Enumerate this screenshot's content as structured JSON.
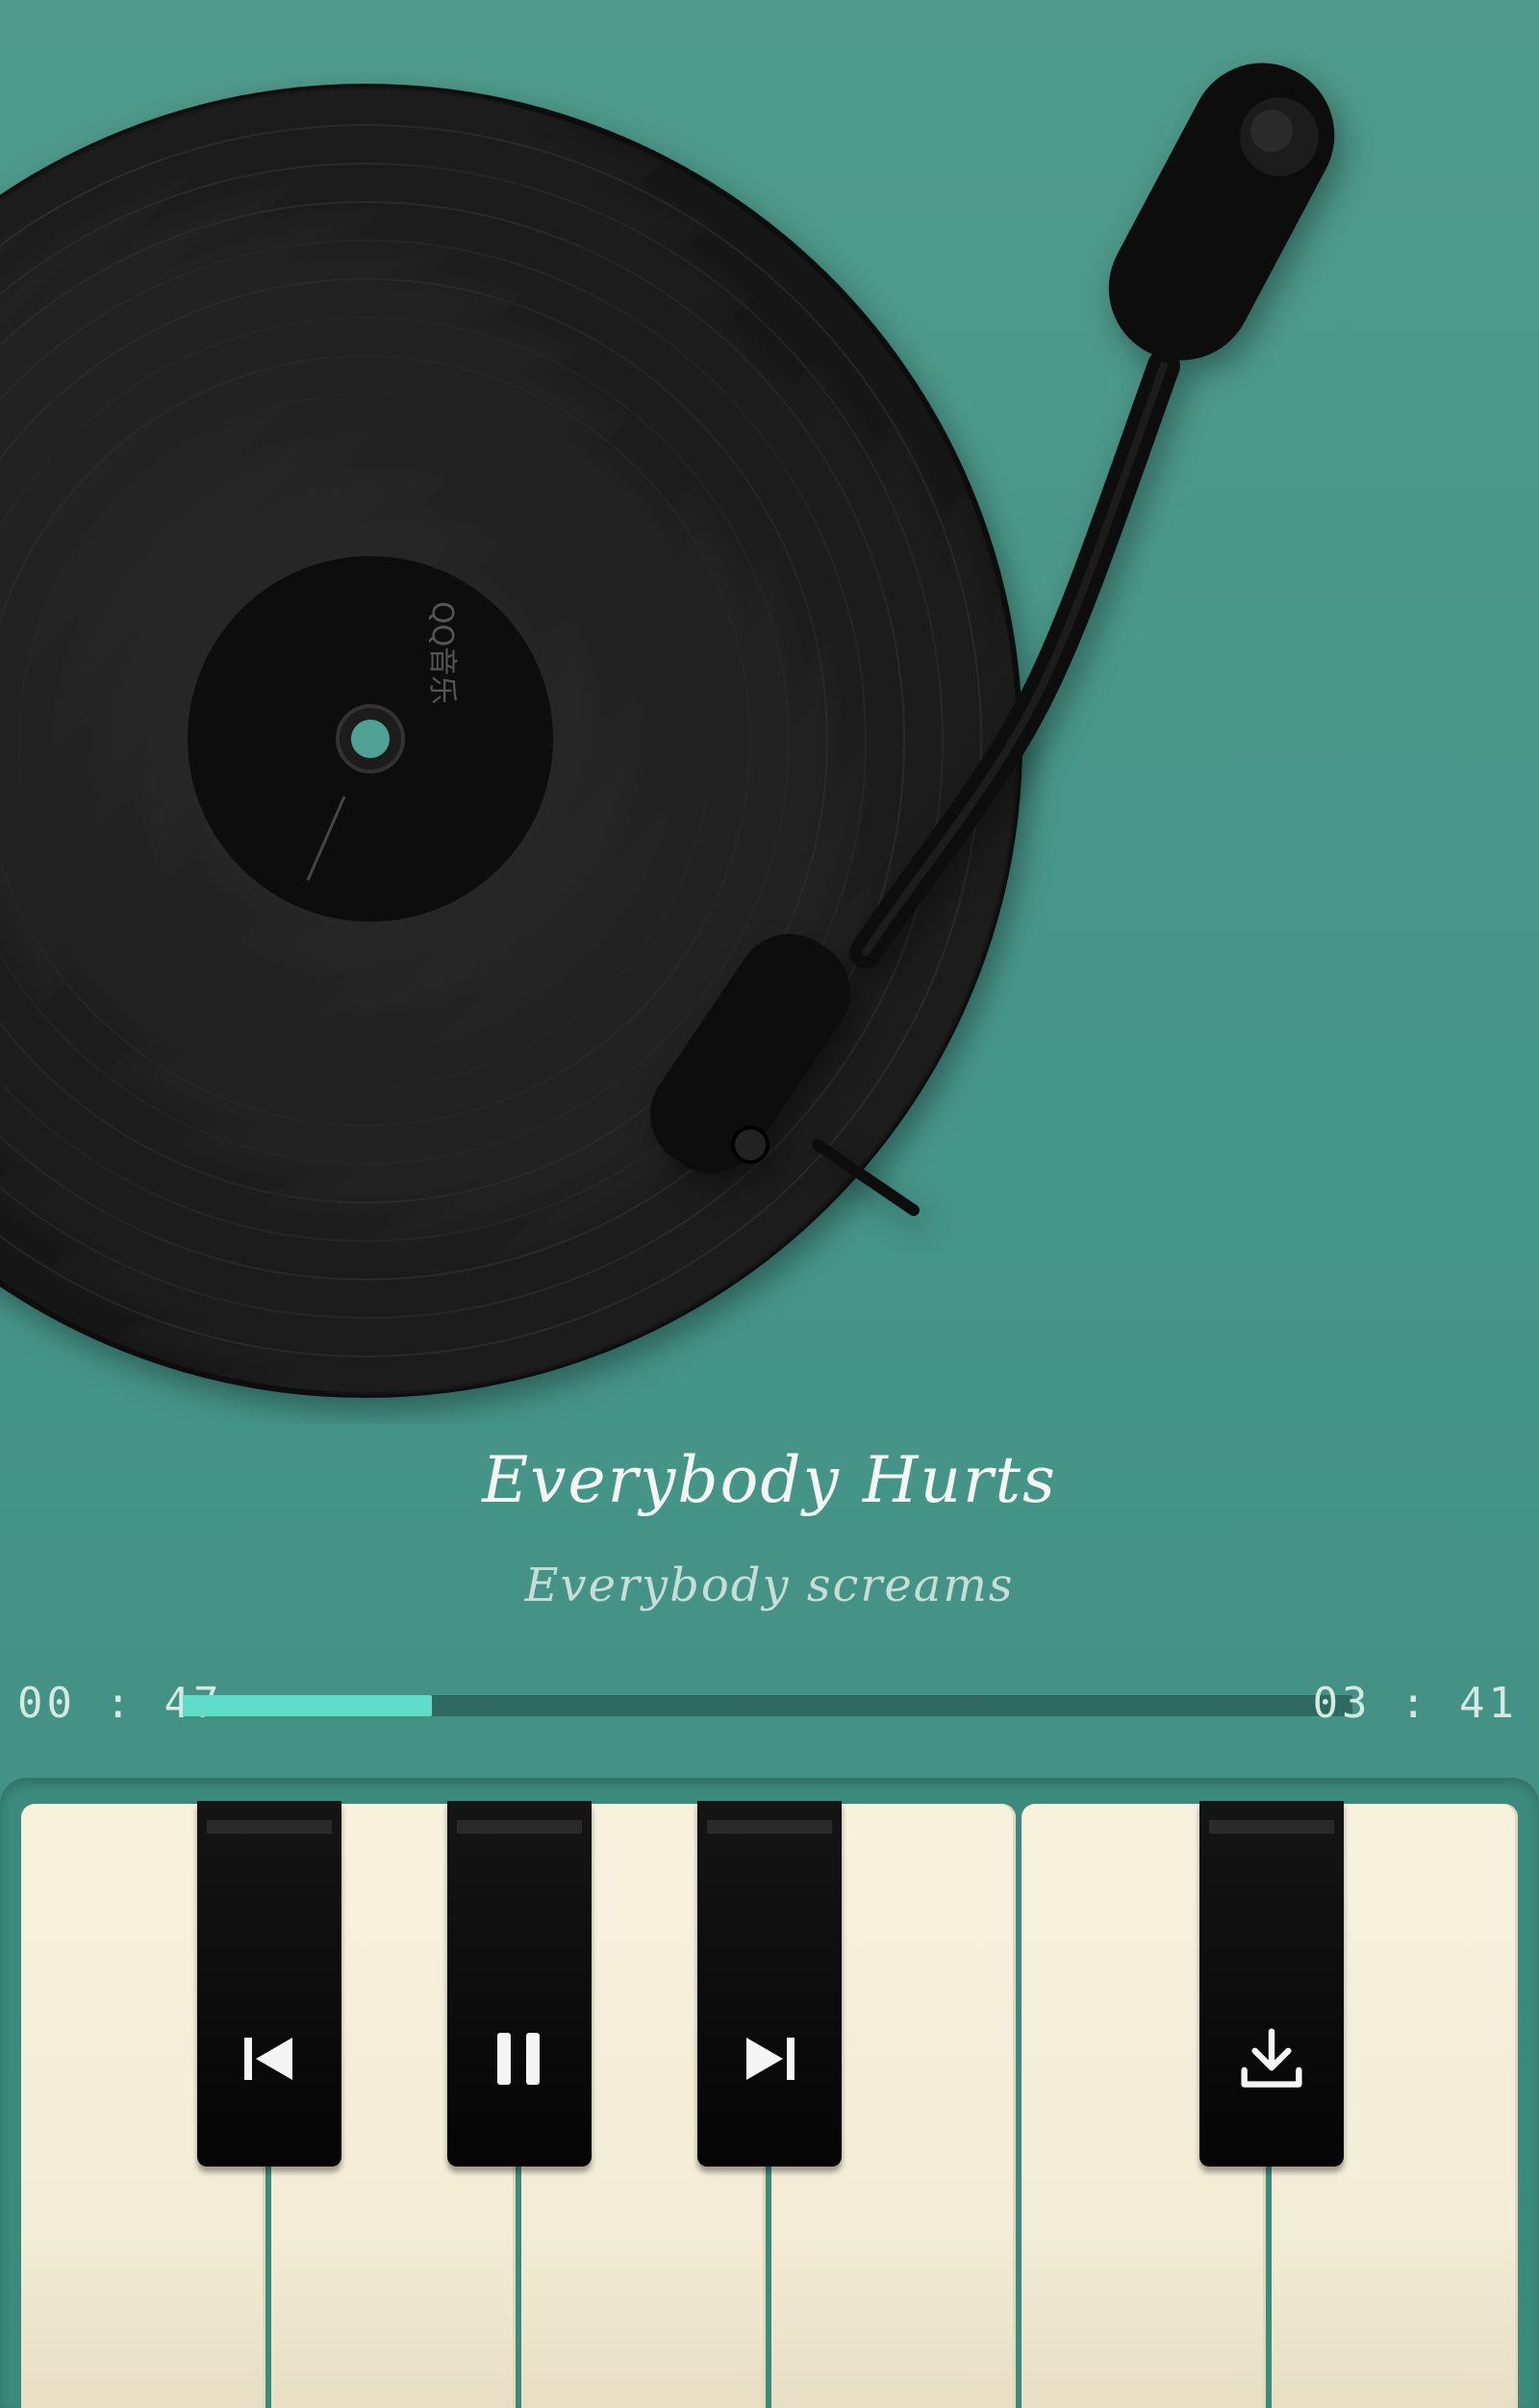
{
  "player": {
    "disc_label": "QQ音乐",
    "song_title": "Everybody  Hurts",
    "lyric_line": "Everybody  screams",
    "time_current": "00 : 47",
    "time_total": "03 : 41",
    "progress_fraction": 0.2126
  },
  "controls": {
    "icons": [
      "previous-icon",
      "pause-icon",
      "next-icon",
      "download-icon"
    ]
  },
  "colors": {
    "background": "#4a9686",
    "progress_fill": "#5fdcc8",
    "progress_track": "#2f6a60",
    "key_white": "#f4edd8",
    "key_black": "#0b0b0b"
  }
}
